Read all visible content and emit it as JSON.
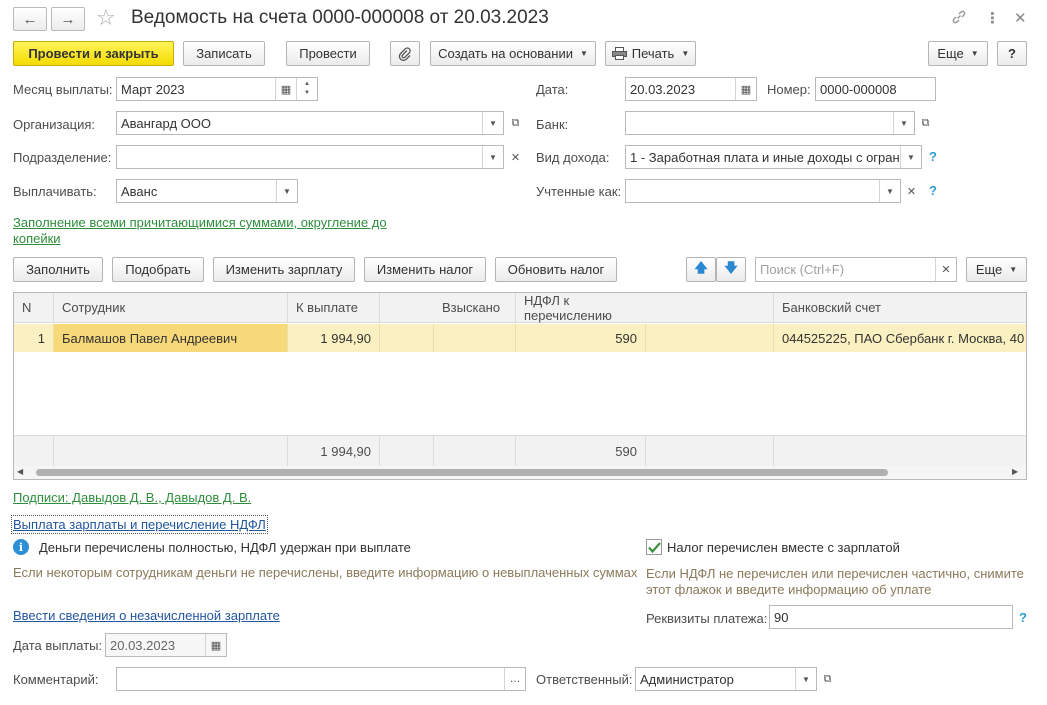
{
  "window": {
    "title": "Ведомость на счета 0000-000008 от 20.03.2023",
    "nav_back": "←",
    "nav_forward": "→",
    "star": "☆",
    "link_icon": "🔗",
    "menu_icon": "⋮",
    "close_icon": "✕"
  },
  "toolbar": {
    "post_close": "Провести и закрыть",
    "save": "Записать",
    "post": "Провести",
    "create_based": "Создать на основании",
    "print": "Печать",
    "more": "Еще",
    "help": "?"
  },
  "form": {
    "month_label": "Месяц выплаты:",
    "month_value": "Март 2023",
    "date_label": "Дата:",
    "date_value": "20.03.2023",
    "number_label": "Номер:",
    "number_value": "0000-000008",
    "org_label": "Организация:",
    "org_value": "Авангард ООО",
    "bank_label": "Банк:",
    "bank_value": "",
    "dept_label": "Подразделение:",
    "dept_value": "",
    "income_label": "Вид дохода:",
    "income_value": "1 - Заработная плата и иные доходы с огран",
    "pay_label": "Выплачивать:",
    "pay_value": "Аванс",
    "counted_label": "Учтенные как:",
    "counted_value": "",
    "fill_link": "Заполнение всеми причитающимися суммами, округление до",
    "fill_link2": "копейки"
  },
  "table_toolbar": {
    "fill": "Заполнить",
    "pick": "Подобрать",
    "change_salary": "Изменить зарплату",
    "change_tax": "Изменить налог",
    "update_tax": "Обновить налог",
    "search_placeholder": "Поиск (Ctrl+F)",
    "more": "Еще"
  },
  "table": {
    "columns": [
      "N",
      "Сотрудник",
      "К выплате",
      "Взыскано",
      "НДФЛ к перечислению",
      "Банковский счет"
    ],
    "rows": [
      {
        "n": "1",
        "employee": "Балмашов Павел Андреевич",
        "to_pay": "1 994,90",
        "collected": "",
        "ndfl": "590",
        "account": "044525225, ПАО Сбербанк г. Москва, 40"
      }
    ],
    "totals": {
      "to_pay": "1 994,90",
      "ndfl": "590"
    }
  },
  "bottom": {
    "signatures_link": "Подписи: Давыдов Д. В., Давыдов Д. В.",
    "payment_link": "Выплата зарплаты и перечисление НДФЛ",
    "info_text": "Деньги перечислены  полностью, НДФЛ удержан при выплате",
    "info_hint": "Если некоторым сотрудникам деньги не перечислены, введите информацию о невыплаченных суммах",
    "tax_checkbox_label": "Налог перечислен вместе с зарплатой",
    "tax_hint_1": "Если НДФЛ не перечислен или перечислен частично, снимите",
    "tax_hint_2": "этот флажок и введите информацию об уплате",
    "unpaid_link": "Ввести сведения о незачисленной зарплате",
    "payment_details_label": "Реквизиты платежа:",
    "payment_details_value": "90",
    "pay_date_label": "Дата выплаты:",
    "pay_date_value": "20.03.2023",
    "comment_label": "Комментарий:",
    "comment_value": "",
    "responsible_label": "Ответственный:",
    "responsible_value": "Администратор"
  }
}
